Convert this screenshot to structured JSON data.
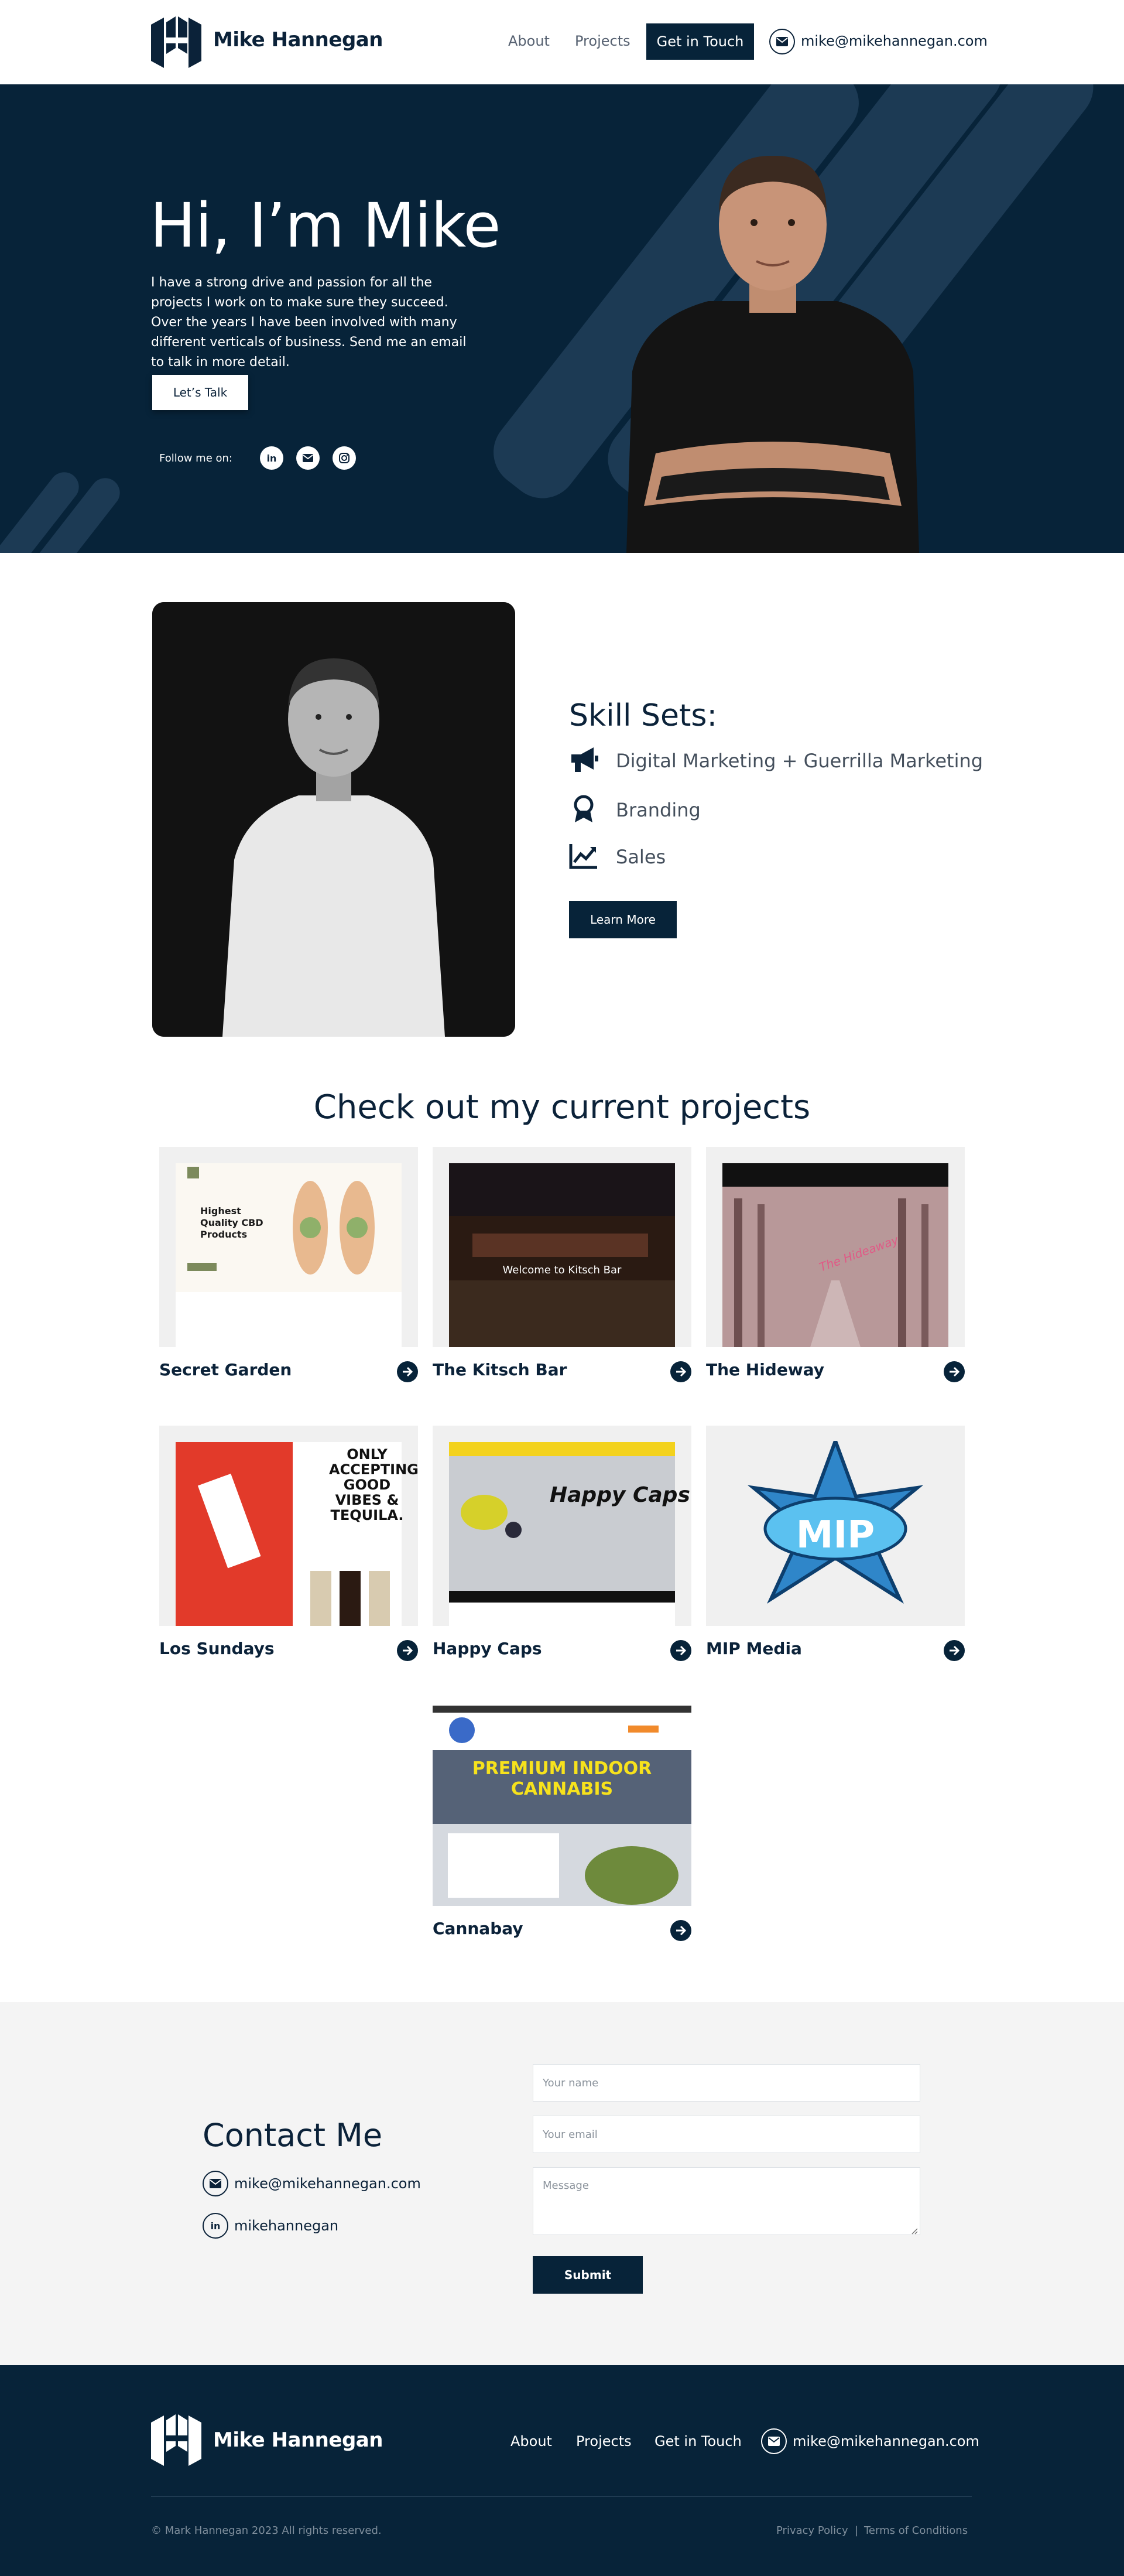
{
  "header": {
    "brand": "Mike Hannegan",
    "nav": [
      "About",
      "Projects"
    ],
    "cta_label": "Get in Touch",
    "email": "mike@mikehannegan.com"
  },
  "hero": {
    "title": "Hi, I’m Mike",
    "description": "I have a strong drive and passion for all the projects I work on to make sure they succeed.  Over the years I have been involved with many different verticals of business.  Send me an email to talk in more detail.",
    "button_label": "Let’s Talk",
    "follow_label": "Follow me on:",
    "social_icons": [
      "linkedin-icon",
      "envelope-icon",
      "instagram-icon"
    ]
  },
  "about": {
    "skills_title": "Skill Sets:",
    "skills": [
      {
        "icon": "megaphone-icon",
        "label": "Digital Marketing + Guerrilla Marketing"
      },
      {
        "icon": "award-icon",
        "label": "Branding"
      },
      {
        "icon": "chart-up-icon",
        "label": "Sales"
      }
    ],
    "button_label": "Learn More"
  },
  "projects": {
    "title": "Check out my current projects",
    "items": [
      {
        "name": "Secret Garden",
        "thumb_text": "Highest Quality CBD Products"
      },
      {
        "name": "The Kitsch Bar",
        "thumb_text": "Welcome to Kitsch Bar"
      },
      {
        "name": "The Hideway",
        "thumb_text": "The Hideaway"
      },
      {
        "name": "Los Sundays",
        "thumb_text": "ONLY ACCEPTING GOOD VIBES & TEQUILA."
      },
      {
        "name": "Happy Caps",
        "thumb_text": "Happy Caps"
      },
      {
        "name": "MIP Media",
        "thumb_text": "MIP"
      },
      {
        "name": "Cannabay",
        "thumb_text": "PREMIUM INDOOR CANNABIS"
      }
    ]
  },
  "contact": {
    "title": "Contact Me",
    "email": "mike@mikehannegan.com",
    "linkedin": "mikehannegan",
    "name_placeholder": "Your name",
    "email_placeholder": "Your email",
    "message_placeholder": "Message",
    "submit_label": "Submit"
  },
  "footer": {
    "brand": "Mike Hannegan",
    "nav": [
      "About",
      "Projects",
      "Get in Touch"
    ],
    "email": "mike@mikehannegan.com",
    "copyright": "© Mark Hannegan 2023 All rights reserved.",
    "privacy": "Privacy Policy",
    "separator": "|",
    "terms": "Terms of Conditions"
  },
  "colors": {
    "navy": "#072339",
    "stripe": "#1c3a54",
    "light_bg": "#f4f4f4",
    "text": "#0b2239"
  }
}
